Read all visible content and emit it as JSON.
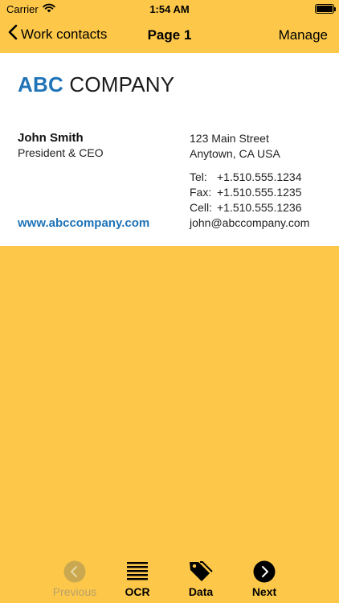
{
  "status": {
    "carrier": "Carrier",
    "time": "1:54 AM"
  },
  "nav": {
    "back_label": "Work contacts",
    "title": "Page 1",
    "manage_label": "Manage"
  },
  "card": {
    "company_abc": "ABC",
    "company_rest": "COMPANY",
    "name": "John Smith",
    "title": "President & CEO",
    "website": "www.abccompany.com",
    "address_line1": "123 Main Street",
    "address_line2": "Anytown, CA USA",
    "tel_label": "Tel:",
    "tel": "+1.510.555.1234",
    "fax_label": "Fax:",
    "fax": "+1.510.555.1235",
    "cell_label": "Cell:",
    "cell": "+1.510.555.1236",
    "email": "john@abccompany.com"
  },
  "toolbar": {
    "previous_label": "Previous",
    "ocr_label": "OCR",
    "data_label": "Data",
    "next_label": "Next"
  },
  "colors": {
    "background": "#FDC84A",
    "brand_blue": "#1F73B7",
    "disabled": "#B9A16A"
  }
}
